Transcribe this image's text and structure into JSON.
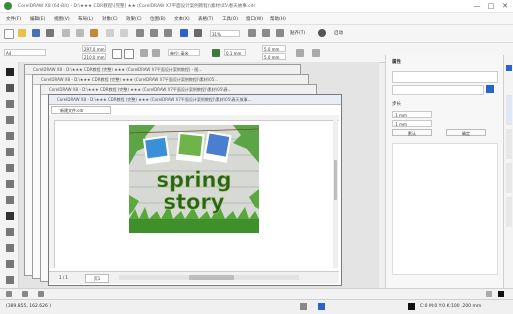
{
  "window": {
    "title": "CorelDRAW X8 (64-Bit) - D:\\★★★ CDR教程\\[完整] ★★ (CorelDRAW X7平面设计案例教程)\\素材\\05\\春天故事.cdr",
    "minimize": "—",
    "maximize": "□",
    "close": "✕"
  },
  "menu": [
    "文件(F)",
    "编辑(E)",
    "视图(V)",
    "布局(L)",
    "对象(C)",
    "效果(C)",
    "位图(B)",
    "文本(X)",
    "表格(T)",
    "工具(O)",
    "窗口(W)",
    "帮助(H)"
  ],
  "toolbar1": {
    "zoom": "31%",
    "snap_label": "贴齐(T)",
    "launch_label": "启动"
  },
  "toolbar2": {
    "paper": "A4",
    "width": "297.0 mm",
    "height": "210.0 mm",
    "units": "单位: 毫米",
    "nudge": "0.1 mm",
    "dup_x": "5.0 mm",
    "dup_y": "5.0 mm"
  },
  "documents": [
    {
      "title": "CorelDRAW X8 - D:\\★★★ CDR教程 (完整) ★★★ (CorelDRAW X7平面设计案例教程) - 图..."
    },
    {
      "title": "CorelDRAW X8 - D:\\★★★ CDR教程 (完整) ★★★ (CorelDRAW X7平面设计案例教程)\\素材\\05..."
    },
    {
      "title": "CorelDRAW X8 - D:\\★★★ CDR教程 (完整) ★★★ (CorelDRAW X7平面设计案例教程)\\素材\\05\\春..."
    },
    {
      "title": "CorelDRAW X8 - D:\\★★★ CDR教程 (完整) ★★★ (CorelDRAW X7平面设计案例教程)\\素材\\05\\春天故事..."
    }
  ],
  "active_tab": "新建文件.cdr",
  "artwork": {
    "line1": "spring",
    "line2": "story"
  },
  "page_nav": {
    "counter": "1 / 1",
    "page_tab": "页1"
  },
  "panel": {
    "header": "属性",
    "section": "步长",
    "value1": ".1 mm",
    "value2": ".1 mm",
    "button1": "默认",
    "button2": "确定"
  },
  "status": {
    "coords": "(389.855, 162.626 )",
    "color_readout": "C:0 M:0 Y:0 K:100 .200 mm"
  },
  "colors": {
    "accent_blue": "#2b63c9",
    "grass_green": "#3f8f2b",
    "text_dark": "#2f5f1f"
  }
}
